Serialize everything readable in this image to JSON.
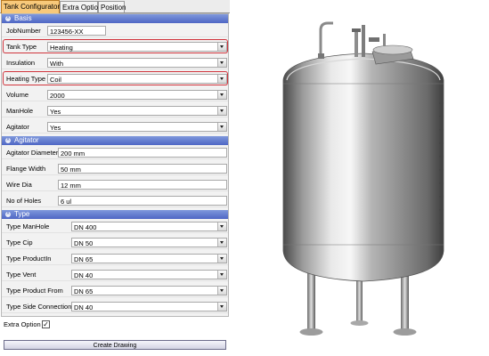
{
  "tabs": [
    "Tank Configurator",
    "Extra Option",
    "Position"
  ],
  "sections": {
    "basis": {
      "title": "Basis",
      "rows": [
        {
          "label": "JobNumber",
          "value": "123456-XX",
          "type": "text"
        },
        {
          "label": "Tank Type",
          "value": "Heating",
          "type": "select"
        },
        {
          "label": "Insulation",
          "value": "With",
          "type": "select"
        },
        {
          "label": "Heating Type",
          "value": "Coil",
          "type": "select"
        },
        {
          "label": "Volume",
          "value": "2000",
          "type": "select"
        },
        {
          "label": "ManHole",
          "value": "Yes",
          "type": "select"
        },
        {
          "label": "Agitator",
          "value": "Yes",
          "type": "select"
        }
      ]
    },
    "agitator": {
      "title": "Agitator",
      "rows": [
        {
          "label": "Agitator Diameter",
          "value": "200 mm",
          "type": "text"
        },
        {
          "label": "Flange Width",
          "value": "50 mm",
          "type": "text"
        },
        {
          "label": "Wire Dia",
          "value": "12 mm",
          "type": "text"
        },
        {
          "label": "No of Holes",
          "value": "6 ul",
          "type": "text"
        }
      ]
    },
    "type": {
      "title": "Type",
      "rows": [
        {
          "label": "Type ManHole",
          "value": "DN 400",
          "type": "select"
        },
        {
          "label": "Type Cip",
          "value": "DN 50",
          "type": "select"
        },
        {
          "label": "Type ProductIn",
          "value": "DN 65",
          "type": "select"
        },
        {
          "label": "Type Vent",
          "value": "DN 40",
          "type": "select"
        },
        {
          "label": "Type Product From",
          "value": "DN 65",
          "type": "select"
        },
        {
          "label": "Type Side Connection",
          "value": "DN 40",
          "type": "select"
        }
      ]
    }
  },
  "extra_option": {
    "label": "Extra Option",
    "checked_mark": "✓"
  },
  "create_button": "Create Drawing",
  "colors": {
    "section_header": "#5b73cc",
    "highlight": "#d0343c",
    "active_tab": "#f8c97a"
  },
  "image": {
    "subject": "stainless-steel-tank-render"
  }
}
